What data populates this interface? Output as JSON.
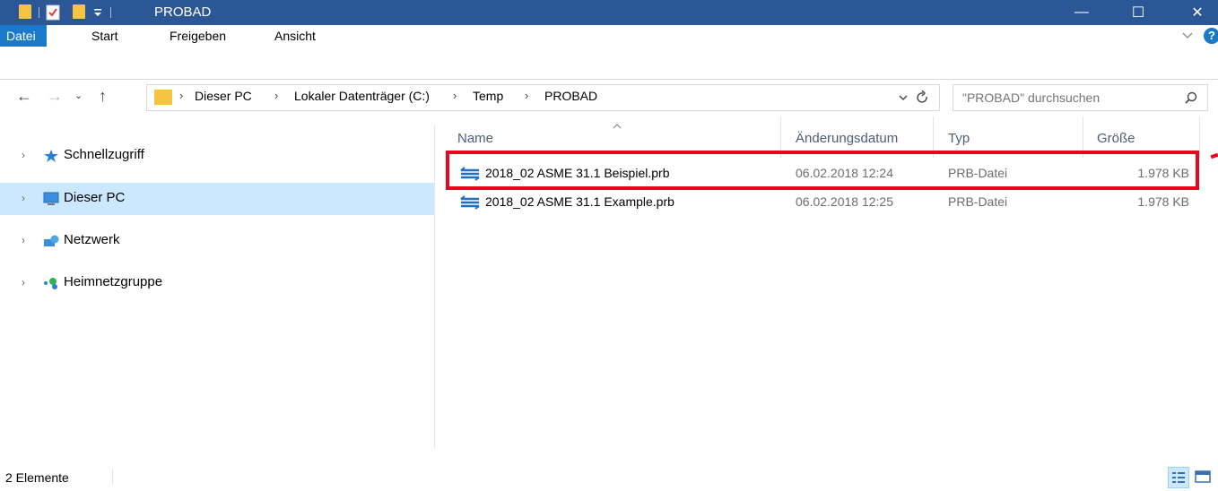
{
  "window": {
    "title": "PROBAD"
  },
  "window_controls": {
    "minimize": "—",
    "maximize": "☐",
    "close": "✕"
  },
  "ribbon": {
    "tabs": [
      {
        "label": "Datei",
        "active": true
      },
      {
        "label": "Start"
      },
      {
        "label": "Freigeben"
      },
      {
        "label": "Ansicht"
      }
    ],
    "collapse_icon": "chevron-down-icon",
    "help_icon": "?"
  },
  "address": {
    "crumbs": [
      "Dieser PC",
      "Lokaler Datenträger (C:)",
      "Temp",
      "PROBAD"
    ],
    "search_placeholder": "\"PROBAD\" durchsuchen"
  },
  "nav_pane": {
    "items": [
      {
        "label": "Schnellzugriff",
        "icon": "star-icon",
        "selected": false
      },
      {
        "label": "Dieser PC",
        "icon": "computer-icon",
        "selected": true
      },
      {
        "label": "Netzwerk",
        "icon": "network-icon",
        "selected": false
      },
      {
        "label": "Heimnetzgruppe",
        "icon": "homegroup-icon",
        "selected": false
      }
    ]
  },
  "columns": {
    "name": "Name",
    "date": "Änderungsdatum",
    "type": "Typ",
    "size": "Größe"
  },
  "files": [
    {
      "name": "2018_02 ASME 31.1 Beispiel.prb",
      "date": "06.02.2018 12:24",
      "type": "PRB-Datei",
      "size": "1.978 KB",
      "highlighted": true
    },
    {
      "name": "2018_02 ASME 31.1 Example.prb",
      "date": "06.02.2018 12:25",
      "type": "PRB-Datei",
      "size": "1.978 KB",
      "highlighted": false
    }
  ],
  "status": {
    "count": "2 Elemente"
  },
  "colors": {
    "titlebar": "#2b5797",
    "accent": "#1979ca",
    "selection": "#cce8ff",
    "highlight": "#e8051d"
  }
}
